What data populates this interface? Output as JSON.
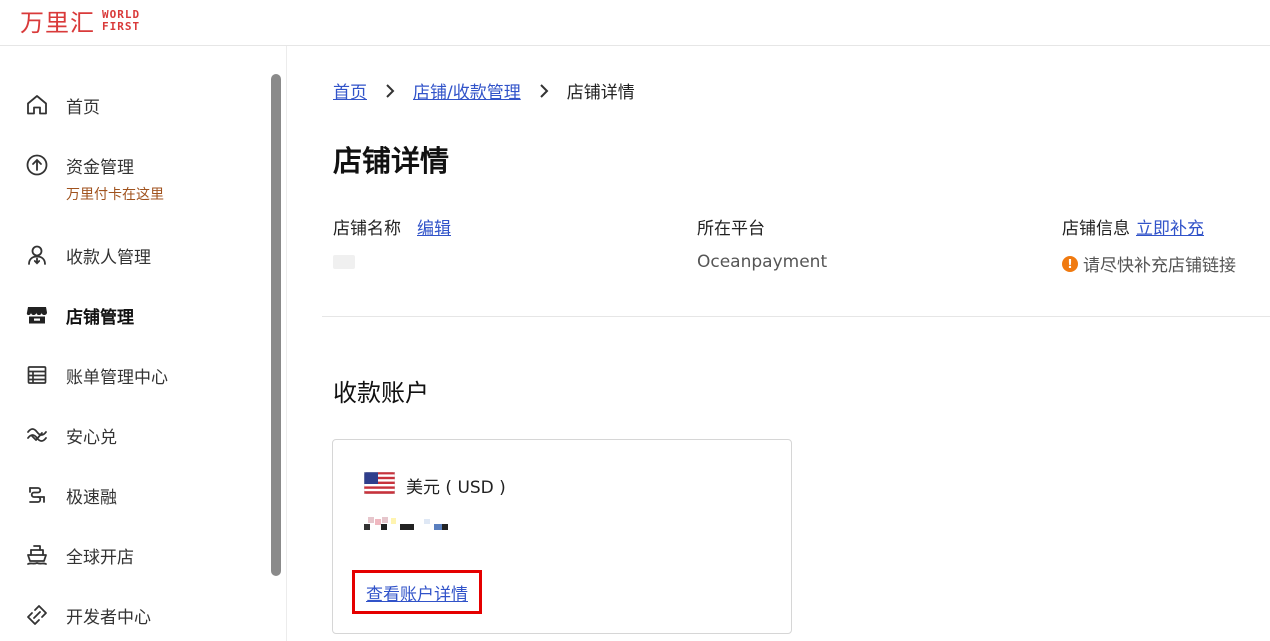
{
  "header": {
    "logo_cn": "万里汇",
    "logo_en_line1": "WORLD",
    "logo_en_line2": "FIRST"
  },
  "sidebar": {
    "items": [
      {
        "label": "首页",
        "icon": "home-icon"
      },
      {
        "label": "资金管理",
        "icon": "upload-circle-icon",
        "sub": "万里付卡在这里"
      },
      {
        "label": "收款人管理",
        "icon": "payee-icon"
      },
      {
        "label": "店铺管理",
        "icon": "store-icon",
        "active": true
      },
      {
        "label": "账单管理中心",
        "icon": "bill-table-icon"
      },
      {
        "label": "安心兑",
        "icon": "exchange-icon"
      },
      {
        "label": "极速融",
        "icon": "finance-icon"
      },
      {
        "label": "全球开店",
        "icon": "ship-icon"
      },
      {
        "label": "开发者中心",
        "icon": "developer-icon"
      }
    ]
  },
  "breadcrumb": {
    "home": "首页",
    "store_mgmt": "店铺/收款管理",
    "current": "店铺详情"
  },
  "page": {
    "title": "店铺详情"
  },
  "store_info": {
    "name_label": "店铺名称",
    "edit_link": "编辑",
    "platform_label": "所在平台",
    "platform_value": "Oceanpayment",
    "info_label": "店铺信息",
    "info_link": "立即补充",
    "warning_text": "请尽快补充店铺链接"
  },
  "accounts": {
    "section_title": "收款账户",
    "card": {
      "currency": "美元 ( USD )",
      "flag": "us-flag-icon",
      "detail_link": "查看账户详情"
    }
  },
  "colors": {
    "brand": "#d93a3a",
    "link": "#3153c9",
    "warning": "#f07a10",
    "highlight": "#e50000"
  }
}
